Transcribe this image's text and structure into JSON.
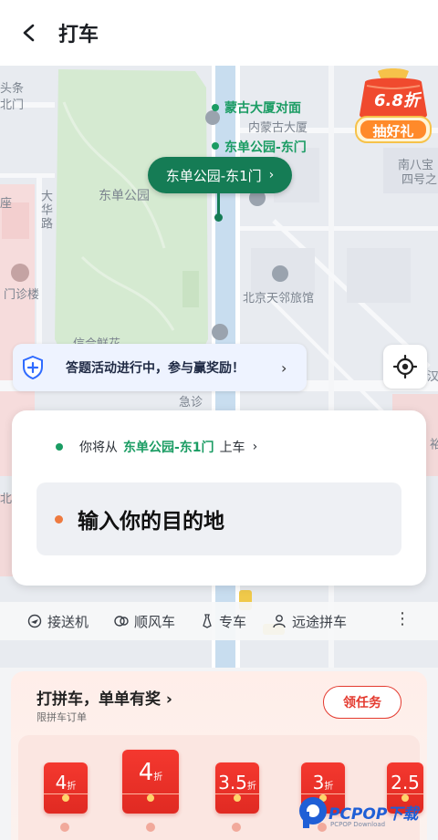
{
  "header": {
    "title": "打车"
  },
  "map": {
    "labels": {
      "poi1": "蒙古大厦对面",
      "poi1_sub": "内蒙古大厦",
      "poi2": "东单公园-东门",
      "park": "东单公园",
      "tl": "头条",
      "tl2": "北门",
      "hua": "大华路",
      "men": "门诊楼",
      "zuo": "座",
      "nan": "南八宝",
      "nan2": "四号之",
      "hotel": "北京天邻旅馆",
      "xin": "信合鲜花",
      "ji": "急诊",
      "han": "汉",
      "yu": "裕",
      "bei": "北"
    },
    "pin_label": "东单公园-东1门",
    "promo": {
      "discount": "6.8折",
      "cta": "抽好礼"
    },
    "quiz_banner": "答题活动进行中，参与赢奖励！"
  },
  "trip": {
    "pickup_prefix": "你将从",
    "pickup_place": "东单公园-东1门",
    "pickup_suffix": "上车",
    "destination_placeholder": "输入你的目的地"
  },
  "services": [
    {
      "label": "接送机",
      "icon": "airplane-icon"
    },
    {
      "label": "顺风车",
      "icon": "car-share-icon"
    },
    {
      "label": "专车",
      "icon": "tie-icon"
    },
    {
      "label": "远途拼车",
      "icon": "carpool-icon"
    }
  ],
  "promo_section": {
    "title": "打拼车，单单有奖",
    "subtitle": "限拼车订单",
    "button": "领任务",
    "envelopes": [
      {
        "num": "4",
        "unit": "折"
      },
      {
        "num": "4",
        "unit": "折"
      },
      {
        "num": "3.5",
        "unit": "折"
      },
      {
        "num": "3",
        "unit": "折"
      },
      {
        "num": "2.5",
        "unit": ""
      }
    ]
  },
  "watermark": {
    "brand": "PCPOP下载",
    "sub": "PCPOP Download"
  },
  "colors": {
    "accent_green": "#157c55",
    "promo_red": "#e43a2f",
    "dest_dot": "#ee7a3f"
  }
}
